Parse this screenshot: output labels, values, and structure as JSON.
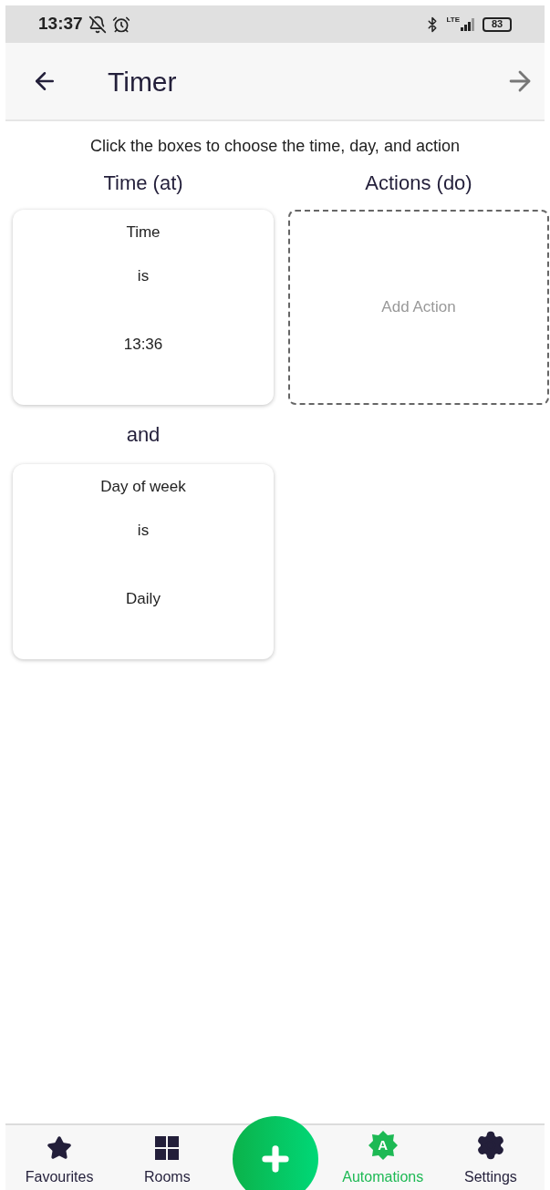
{
  "status_bar": {
    "time": "13:37",
    "network": "LTE",
    "battery": "83"
  },
  "header": {
    "title": "Timer"
  },
  "instructions": "Click the boxes to choose the time, day, and action",
  "conditions_heading": "Time (at)",
  "actions_heading": "Actions (do)",
  "conditions": [
    {
      "label": "Time",
      "operator": "is",
      "value": "13:36"
    },
    {
      "label": "Day of week",
      "operator": "is",
      "value": "Daily"
    }
  ],
  "connectors": [
    "and"
  ],
  "actions": {
    "placeholder": "Add Action"
  },
  "nav": [
    {
      "kind": "star",
      "label": "Favourites",
      "selected": false
    },
    {
      "kind": "grid",
      "label": "Rooms",
      "selected": false
    },
    {
      "kind": "fab"
    },
    {
      "kind": "badge",
      "label": "Automations",
      "badge": "A",
      "selected": true
    },
    {
      "kind": "gear",
      "label": "Settings",
      "selected": false
    }
  ]
}
